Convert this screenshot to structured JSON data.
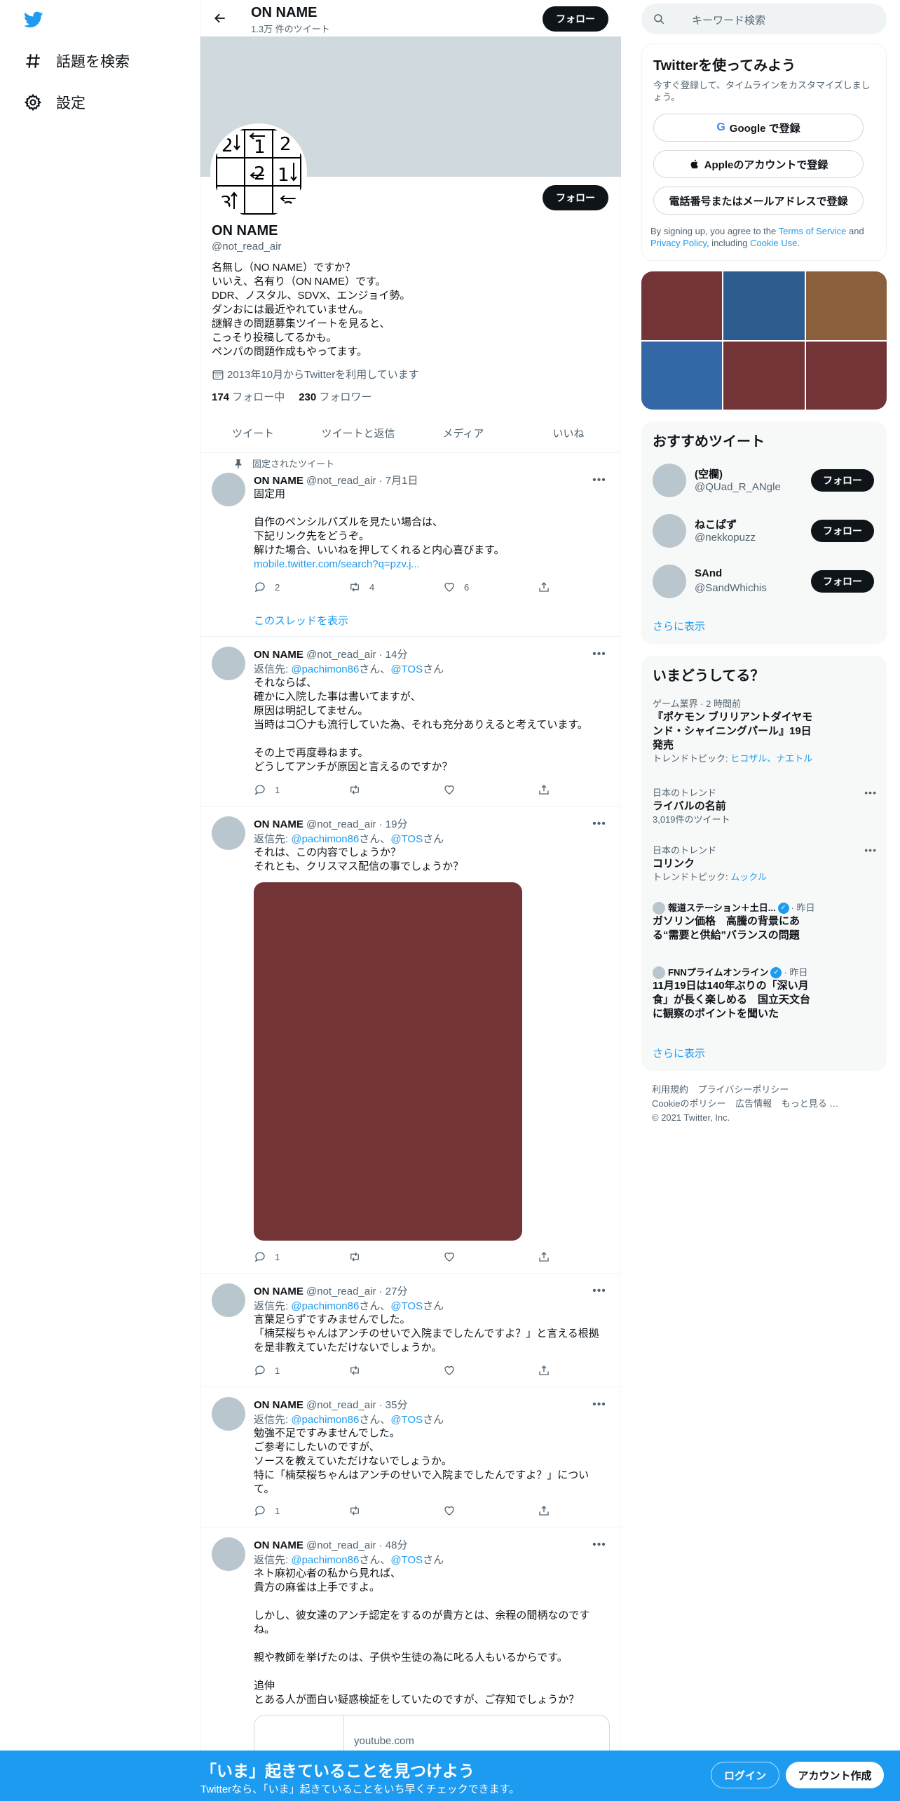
{
  "colors": {
    "accent": "#1d9bf0",
    "text": "#0f1419",
    "muted": "#536471",
    "banner": "#cfd9de"
  },
  "nav": {
    "items": [
      {
        "label": "話題を検索",
        "icon": "hashtag-icon"
      },
      {
        "label": "設定",
        "icon": "gear-icon"
      }
    ]
  },
  "header": {
    "name": "ON NAME",
    "tweet_count": "1.3万 件のツイート",
    "follow_label": "フォロー"
  },
  "profile": {
    "name": "ON NAME",
    "handle": "@not_read_air",
    "follow_label": "フォロー",
    "bio": [
      "名無し（NO NAME）ですか？",
      "いいえ、名有り（ON NAME）です。",
      "DDR、ノスタル、SDVX、エンジョイ勢。",
      "ダンおには最近やれていません。",
      "謎解きの問題募集ツイートを見ると、",
      "こっそり投稿してるかも。",
      "ペンパの問題作成もやってます。"
    ],
    "joined": "2013年10月からTwitterを利用しています",
    "following_count": "174",
    "following_label": "フォロー中",
    "followers_count": "230",
    "followers_label": "フォロワー",
    "avatar_digits": [
      "2",
      "1",
      "2",
      "2",
      "1",
      "3",
      "2"
    ]
  },
  "tabs": [
    "ツイート",
    "ツイートと返信",
    "メディア",
    "いいね"
  ],
  "pinned_label": "固定されたツイート",
  "tweets": [
    {
      "name": "ON NAME",
      "meta": "@not_read_air · 7月1日",
      "lines": [
        "固定用",
        "",
        "自作のペンシルパズルを見たい場合は、",
        "下記リンク先をどうぞ。",
        "解けた場合、いいねを押してくれると内心喜びます。"
      ],
      "link": "mobile.twitter.com/search?q=pzv.j...",
      "replies": "2",
      "retweets": "4",
      "likes": "6",
      "show_thread": "このスレッドを表示"
    },
    {
      "name": "ON NAME",
      "meta": "@not_read_air · 14分",
      "reply_prefix": "返信先: ",
      "reply_to_1": "@pachimon86",
      "reply_mid": "さん、",
      "reply_to_2": "@TOS",
      "reply_suffix": "さん",
      "lines": [
        "それならば、",
        "確かに入院した事は書いてますが、",
        "原因は明記してません。",
        "当時はコ〇ナも流行していた為、それも充分ありえると考えています。",
        "",
        "その上で再度尋ねます。",
        "どうしてアンチが原因と言えるのですか？"
      ],
      "replies": "1"
    },
    {
      "name": "ON NAME",
      "meta": "@not_read_air · 19分",
      "reply_prefix": "返信先: ",
      "reply_to_1": "@pachimon86",
      "reply_mid": "さん、",
      "reply_to_2": "@TOS",
      "reply_suffix": "さん",
      "lines": [
        "それは、この内容でしょうか？",
        "それとも、クリスマス配信の事でしょうか？"
      ],
      "replies": "1"
    },
    {
      "name": "ON NAME",
      "meta": "@not_read_air · 27分",
      "reply_prefix": "返信先: ",
      "reply_to_1": "@pachimon86",
      "reply_mid": "さん、",
      "reply_to_2": "@TOS",
      "reply_suffix": "さん",
      "lines": [
        "言葉足らずですみませんでした。",
        "「楠栞桜ちゃんはアンチのせいで入院までしたんですよ？」と言える根拠",
        "を是非教えていただけないでしょうか。"
      ],
      "replies": "1"
    },
    {
      "name": "ON NAME",
      "meta": "@not_read_air · 35分",
      "reply_prefix": "返信先: ",
      "reply_to_1": "@pachimon86",
      "reply_mid": "さん、",
      "reply_to_2": "@TOS",
      "reply_suffix": "さん",
      "lines": [
        "勉強不足ですみませんでした。",
        "ご参考にしたいのですが、",
        "ソースを教えていただけないでしょうか。",
        "特に「楠栞桜ちゃんはアンチのせいで入院までしたんですよ？」につい",
        "て。"
      ],
      "replies": "1"
    },
    {
      "name": "ON NAME",
      "meta": "@not_read_air · 48分",
      "reply_prefix": "返信先: ",
      "reply_to_1": "@pachimon86",
      "reply_mid": "さん、",
      "reply_to_2": "@TOS",
      "reply_suffix": "さん",
      "lines": [
        "ネト麻初心者の私から見れば、",
        "貴方の麻雀は上手ですよ。",
        "",
        "しかし、彼女達のアンチ認定をするのが貴方とは、余程の間柄なのです",
        "ね。",
        "",
        "親や教師を挙げたのは、子供や生徒の為に叱る人もいるからです。",
        "",
        "追伸",
        "とある人が面白い疑惑検証をしていたのですが、ご存知でしょうか？"
      ],
      "card_domain": "youtube.com"
    }
  ],
  "search": {
    "placeholder": "キーワード検索"
  },
  "signup": {
    "title": "Twitterを使ってみよう",
    "subtitle": "今すぐ登録して、タイムラインをカスタマイズしましょう。",
    "google": "Google で登録",
    "apple": "Appleのアカウントで登録",
    "phone": "電話番号またはメールアドレスで登録",
    "terms_1": "By signing up, you agree to the ",
    "terms_tos": "Terms of Service",
    "terms_and": " and ",
    "terms_privacy": "Privacy Policy",
    "terms_incl": ", including ",
    "terms_cookie": "Cookie Use",
    "terms_end": "."
  },
  "media_grid": {
    "colors": [
      "#733437",
      "#2d5c8e",
      "#8b5e3c",
      "#3367a6",
      "#733437",
      "#733437"
    ]
  },
  "recommended": {
    "title": "おすすめツイート",
    "users": [
      {
        "name": "(空欄)",
        "handle": "@QUad_R_ANgle",
        "follow": "フォロー"
      },
      {
        "name": "ねこぱず",
        "handle": "@nekkopuzz",
        "follow": "フォロー"
      },
      {
        "name": "SAnd",
        "handle": "@SandWhichis",
        "follow": "フォロー"
      }
    ],
    "more": "さらに表示"
  },
  "trends": {
    "title": "いまどうしてる？",
    "items": [
      {
        "category": "ゲーム業界 · 2 時間前",
        "title_lines": [
          "『ポケモン ブリリアントダイヤモ",
          "ンド・シャイニングパール』19日",
          "発売"
        ],
        "sub_prefix": "トレンドトピック: ",
        "sub_links": "ヒコザル、ナエトル"
      },
      {
        "category": "日本のトレンド",
        "title_lines": [
          "ライバルの名前"
        ],
        "sub_text": "3,019件のツイート"
      },
      {
        "category": "日本のトレンド",
        "title_lines": [
          "コリンク"
        ],
        "sub_prefix": "トレンドトピック: ",
        "sub_links": "ムックル"
      },
      {
        "source": "報道ステーション＋土日...",
        "time": "· 昨日",
        "title_lines": [
          "ガソリン価格　高騰の背景にあ",
          "る“需要と供給”バランスの問題"
        ]
      },
      {
        "source": "FNNプライムオンライン",
        "time": "· 昨日",
        "title_lines": [
          "11月19日は140年ぶりの「深い月",
          "食」が長く楽しめる　国立天文台",
          "に観察のポイントを聞いた"
        ]
      }
    ],
    "more": "さらに表示"
  },
  "footer": {
    "links": [
      "利用規約",
      "プライバシーポリシー",
      "Cookieのポリシー",
      "広告情報",
      "もっと見る …"
    ],
    "copyright": "© 2021 Twitter, Inc."
  },
  "bottom": {
    "title": "「いま」起きていることを見つけよう",
    "subtitle": "Twitterなら、「いま」起きていることをいち早くチェックできます。",
    "login": "ログイン",
    "signup": "アカウント作成"
  }
}
